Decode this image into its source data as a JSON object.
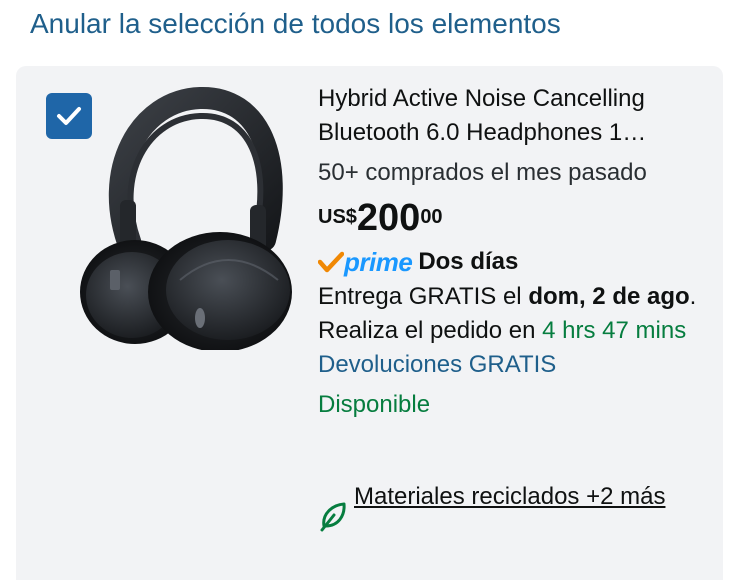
{
  "header": {
    "deselect_all_label": "Anular la selección de todos los elementos"
  },
  "product": {
    "selected": true,
    "title": "Hybrid Active Noise Cancelling Bluetooth 6.0 Headphones 1…",
    "bought_past_month": "50+ comprados el mes pasado",
    "price": {
      "currency": "US$",
      "whole": "200",
      "fraction": "00"
    },
    "prime": {
      "logo_text": "prime",
      "speed": "Dos días"
    },
    "delivery": {
      "prefix": "Entrega GRATIS el ",
      "date": "dom, 2 de ago",
      "middle": ". Realiza el pedido en ",
      "countdown": "4 hrs 47 mins"
    },
    "returns": "Devoluciones GRATIS",
    "availability": "Disponible",
    "eco_badge": "Materiales reciclados +2 más"
  },
  "colors": {
    "link_blue": "#1f5f8b",
    "checkbox_blue": "#1f66a8",
    "prime_blue": "#1a98ff",
    "prime_check_orange": "#f08804",
    "in_stock_green": "#067d3f",
    "card_background": "#f2f3f5"
  },
  "icons": {
    "checkbox": "checkmark-icon",
    "prime": "prime-checkmark-icon",
    "eco": "leaf-icon",
    "image": "headphones-image"
  }
}
